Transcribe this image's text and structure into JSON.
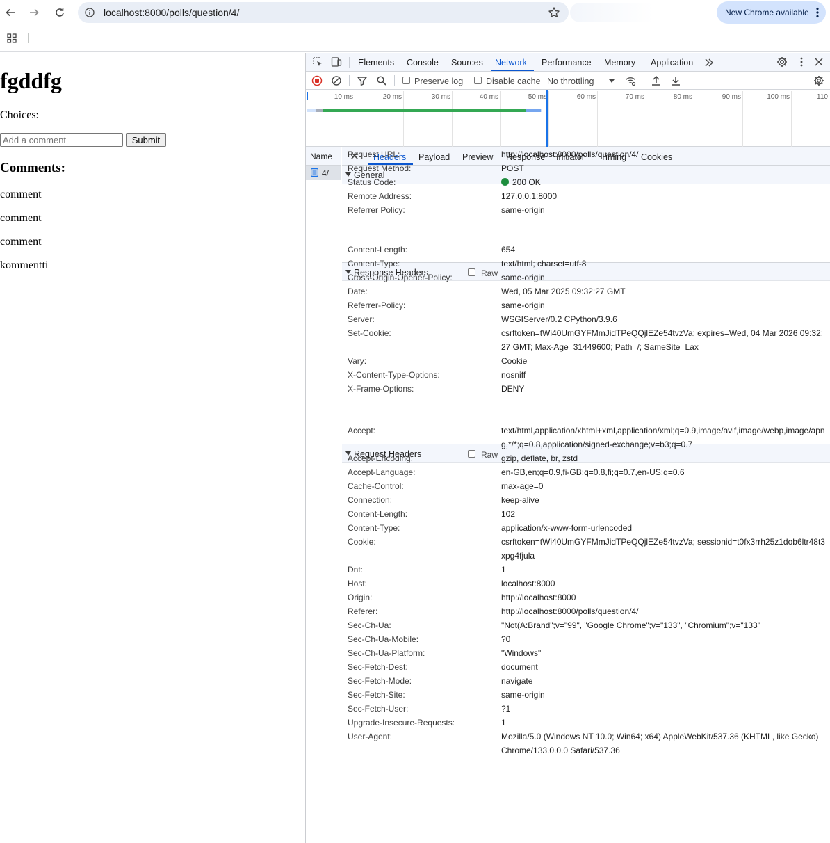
{
  "browser": {
    "url": "localhost:8000/polls/question/4/",
    "update_label": "New Chrome available"
  },
  "page": {
    "title": "fgddfg",
    "choices_label": "Choices:",
    "comment_placeholder": "Add a comment",
    "submit_label": "Submit",
    "comments_heading": "Comments:",
    "comments": [
      "comment",
      "comment",
      "comment",
      "kommentti"
    ]
  },
  "devtools": {
    "tabs": [
      "Elements",
      "Console",
      "Sources",
      "Network",
      "Performance",
      "Memory",
      "Application"
    ],
    "active_tab": "Network",
    "toolbar": {
      "preserve_log": "Preserve log",
      "disable_cache": "Disable cache",
      "throttling": "No throttling"
    },
    "overview_ticks": [
      "10 ms",
      "20 ms",
      "30 ms",
      "40 ms",
      "50 ms",
      "60 ms",
      "70 ms",
      "80 ms",
      "90 ms",
      "100 ms",
      "110"
    ],
    "name_header": "Name",
    "request_name": "4/",
    "detail_tabs": [
      "Headers",
      "Payload",
      "Preview",
      "Response",
      "Initiator",
      "Timing",
      "Cookies"
    ],
    "active_detail_tab": "Headers",
    "raw_label": "Raw",
    "general": {
      "title": "General",
      "rows": [
        {
          "k": "Request URL:",
          "v": "http://localhost:8000/polls/question/4/"
        },
        {
          "k": "Request Method:",
          "v": "POST"
        },
        {
          "k": "Status Code:",
          "v": "200 OK"
        },
        {
          "k": "Remote Address:",
          "v": "127.0.0.1:8000"
        },
        {
          "k": "Referrer Policy:",
          "v": "same-origin"
        }
      ]
    },
    "response_headers": {
      "title": "Response Headers",
      "rows": [
        {
          "k": "Content-Length:",
          "v": "654"
        },
        {
          "k": "Content-Type:",
          "v": "text/html; charset=utf-8"
        },
        {
          "k": "Cross-Origin-Opener-Policy:",
          "v": "same-origin"
        },
        {
          "k": "Date:",
          "v": "Wed, 05 Mar 2025 09:32:27 GMT"
        },
        {
          "k": "Referrer-Policy:",
          "v": "same-origin"
        },
        {
          "k": "Server:",
          "v": "WSGIServer/0.2 CPython/3.9.6"
        },
        {
          "k": "Set-Cookie:",
          "v": "csrftoken=tWi40UmGYFMmJidTPeQQjlEZe54tvzVa; expires=Wed, 04 Mar 2026 09:32:27 GMT; Max-Age=31449600; Path=/; SameSite=Lax"
        },
        {
          "k": "Vary:",
          "v": "Cookie"
        },
        {
          "k": "X-Content-Type-Options:",
          "v": "nosniff"
        },
        {
          "k": "X-Frame-Options:",
          "v": "DENY"
        }
      ]
    },
    "request_headers": {
      "title": "Request Headers",
      "rows": [
        {
          "k": "Accept:",
          "v": "text/html,application/xhtml+xml,application/xml;q=0.9,image/avif,image/webp,image/apng,*/*;q=0.8,application/signed-exchange;v=b3;q=0.7"
        },
        {
          "k": "Accept-Encoding:",
          "v": "gzip, deflate, br, zstd"
        },
        {
          "k": "Accept-Language:",
          "v": "en-GB,en;q=0.9,fi-GB;q=0.8,fi;q=0.7,en-US;q=0.6"
        },
        {
          "k": "Cache-Control:",
          "v": "max-age=0"
        },
        {
          "k": "Connection:",
          "v": "keep-alive"
        },
        {
          "k": "Content-Length:",
          "v": "102"
        },
        {
          "k": "Content-Type:",
          "v": "application/x-www-form-urlencoded"
        },
        {
          "k": "Cookie:",
          "v": "csrftoken=tWi40UmGYFMmJidTPeQQjlEZe54tvzVa; sessionid=t0fx3rrh25z1dob6ltr48t3xpg4fjula"
        },
        {
          "k": "Dnt:",
          "v": "1"
        },
        {
          "k": "Host:",
          "v": "localhost:8000"
        },
        {
          "k": "Origin:",
          "v": "http://localhost:8000"
        },
        {
          "k": "Referer:",
          "v": "http://localhost:8000/polls/question/4/"
        },
        {
          "k": "Sec-Ch-Ua:",
          "v": "\"Not(A:Brand\";v=\"99\", \"Google Chrome\";v=\"133\", \"Chromium\";v=\"133\""
        },
        {
          "k": "Sec-Ch-Ua-Mobile:",
          "v": "?0"
        },
        {
          "k": "Sec-Ch-Ua-Platform:",
          "v": "\"Windows\""
        },
        {
          "k": "Sec-Fetch-Dest:",
          "v": "document"
        },
        {
          "k": "Sec-Fetch-Mode:",
          "v": "navigate"
        },
        {
          "k": "Sec-Fetch-Site:",
          "v": "same-origin"
        },
        {
          "k": "Sec-Fetch-User:",
          "v": "?1"
        },
        {
          "k": "Upgrade-Insecure-Requests:",
          "v": "1"
        },
        {
          "k": "User-Agent:",
          "v": "Mozilla/5.0 (Windows NT 10.0; Win64; x64) AppleWebKit/537.36 (KHTML, like Gecko) Chrome/133.0.0.0 Safari/537.36"
        }
      ]
    }
  }
}
